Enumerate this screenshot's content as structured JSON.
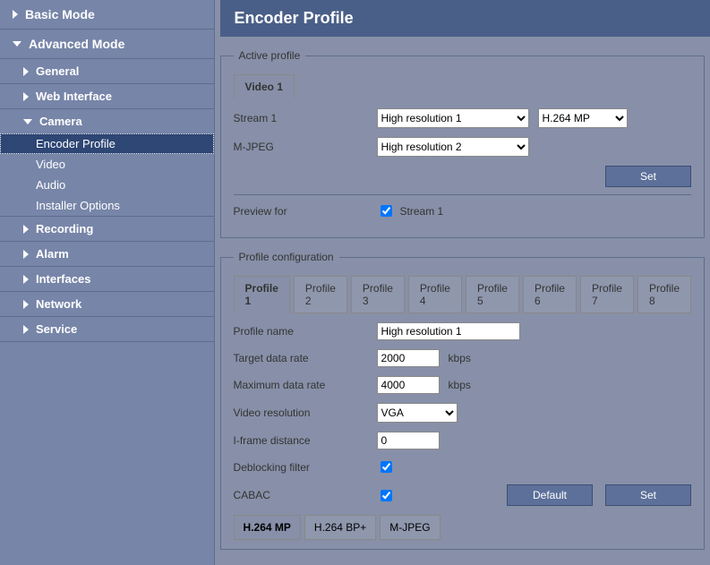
{
  "sidebar": {
    "basic_mode_label": "Basic Mode",
    "advanced_mode_label": "Advanced Mode",
    "sections": [
      {
        "label": "General",
        "expanded": false
      },
      {
        "label": "Web Interface",
        "expanded": false
      },
      {
        "label": "Camera",
        "expanded": true,
        "children": [
          {
            "label": "Encoder Profile",
            "active": true
          },
          {
            "label": "Video"
          },
          {
            "label": "Audio"
          },
          {
            "label": "Installer Options"
          }
        ]
      },
      {
        "label": "Recording",
        "expanded": false
      },
      {
        "label": "Alarm",
        "expanded": false
      },
      {
        "label": "Interfaces",
        "expanded": false
      },
      {
        "label": "Network",
        "expanded": false
      },
      {
        "label": "Service",
        "expanded": false
      }
    ]
  },
  "page": {
    "title": "Encoder Profile"
  },
  "active_profile": {
    "legend": "Active profile",
    "tab_label": "Video 1",
    "stream1_label": "Stream 1",
    "stream1_profile_value": "High resolution 1",
    "stream1_codec_value": "H.264 MP",
    "mjpeg_label": "M-JPEG",
    "mjpeg_profile_value": "High resolution 2",
    "set_label": "Set",
    "preview_for_label": "Preview for",
    "preview_checkbox_label": "Stream 1",
    "preview_checked": true
  },
  "profile_config": {
    "legend": "Profile configuration",
    "tabs": [
      "Profile 1",
      "Profile 2",
      "Profile 3",
      "Profile 4",
      "Profile 5",
      "Profile 6",
      "Profile 7",
      "Profile 8"
    ],
    "active_tab_index": 0,
    "profile_name_label": "Profile name",
    "profile_name_value": "High resolution 1",
    "target_rate_label": "Target data rate",
    "target_rate_value": "2000",
    "max_rate_label": "Maximum data rate",
    "max_rate_value": "4000",
    "rate_unit": "kbps",
    "video_res_label": "Video resolution",
    "video_res_value": "VGA",
    "iframe_label": "I-frame distance",
    "iframe_value": "0",
    "deblocking_label": "Deblocking filter",
    "deblocking_checked": true,
    "cabac_label": "CABAC",
    "cabac_checked": true,
    "default_label": "Default",
    "set_label": "Set",
    "enc_tabs": [
      "H.264 MP",
      "H.264 BP+",
      "M-JPEG"
    ],
    "enc_active_index": 0
  }
}
